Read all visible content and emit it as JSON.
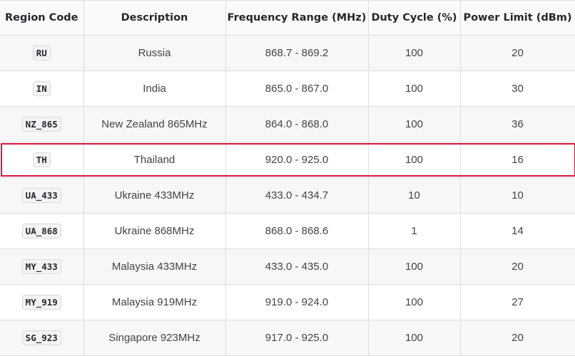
{
  "table": {
    "headers": [
      "Region Code",
      "Description",
      "Frequency Range (MHz)",
      "Duty Cycle (%)",
      "Power Limit (dBm)"
    ],
    "rows": [
      {
        "code": "RU",
        "description": "Russia",
        "frequency": "868.7 - 869.2",
        "duty": "100",
        "power": "20"
      },
      {
        "code": "IN",
        "description": "India",
        "frequency": "865.0 - 867.0",
        "duty": "100",
        "power": "30"
      },
      {
        "code": "NZ_865",
        "description": "New Zealand 865MHz",
        "frequency": "864.0 - 868.0",
        "duty": "100",
        "power": "36"
      },
      {
        "code": "TH",
        "description": "Thailand",
        "frequency": "920.0 - 925.0",
        "duty": "100",
        "power": "16"
      },
      {
        "code": "UA_433",
        "description": "Ukraine 433MHz",
        "frequency": "433.0 - 434.7",
        "duty": "10",
        "power": "10"
      },
      {
        "code": "UA_868",
        "description": "Ukraine 868MHz",
        "frequency": "868.0 - 868.6",
        "duty": "1",
        "power": "14"
      },
      {
        "code": "MY_433",
        "description": "Malaysia 433MHz",
        "frequency": "433.0 - 435.0",
        "duty": "100",
        "power": "20"
      },
      {
        "code": "MY_919",
        "description": "Malaysia 919MHz",
        "frequency": "919.0 - 924.0",
        "duty": "100",
        "power": "27"
      },
      {
        "code": "SG_923",
        "description": "Singapore 923MHz",
        "frequency": "917.0 - 925.0",
        "duty": "100",
        "power": "20"
      }
    ],
    "highlight_color": "#dc143c"
  }
}
